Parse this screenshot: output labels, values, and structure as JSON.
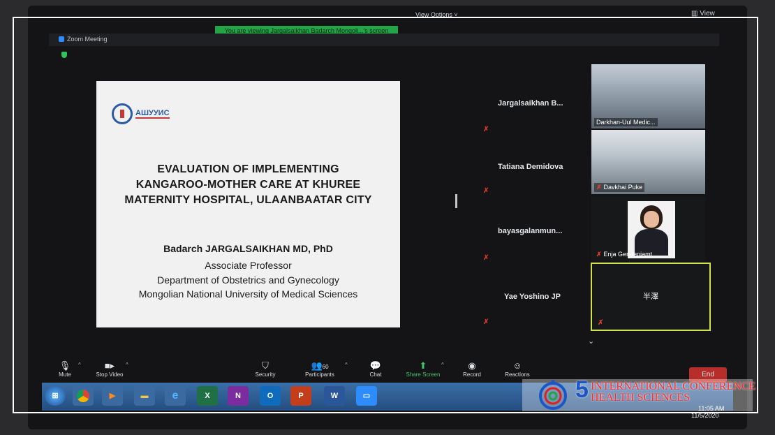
{
  "window": {
    "app_title": "Zoom Meeting",
    "viewing_banner": "You are viewing Jargalsaikhan Badarch Mongoli...'s screen",
    "view_options": "View Options ˅",
    "view_button": "View"
  },
  "slide": {
    "logo_text": "АШУУИС",
    "title_lines": [
      "EVALUATION OF IMPLEMENTING",
      "KANGAROO-MOTHER CARE AT KHUREE",
      "MATERNITY HOSPITAL, ULAANBAATAR CITY"
    ],
    "author": "Badarch JARGALSAIKHAN MD, PhD",
    "role": "Associate Professor",
    "department": "Department of Obstetrics and Gynecology",
    "university": "Mongolian National University of Medical Sciences"
  },
  "participants": [
    {
      "name": "Jargalsaikhan B...",
      "tile_label": "Darkhan-Uul Medic..."
    },
    {
      "name": "Tatiana Demidova",
      "tile_label": "Davkhai Puke"
    },
    {
      "name": "bayasgalanmun...",
      "tile_label": "Enja Gendenjamt..."
    },
    {
      "name": "Yae Yoshino JP",
      "tile_label": "半澤"
    }
  ],
  "toolbar": {
    "mute": "Mute",
    "stop_video": "Stop Video",
    "security": "Security",
    "participants": "Participants",
    "participants_count": "60",
    "chat": "Chat",
    "share_screen": "Share Screen",
    "record": "Record",
    "reactions": "Reactions",
    "end": "End"
  },
  "taskbar": {
    "clock": "11:05 AM",
    "date": "11/5/2020",
    "apps": [
      "start-icon",
      "chrome-icon",
      "media-player-icon",
      "file-explorer-icon",
      "internet-explorer-icon",
      "excel-icon",
      "onenote-icon",
      "outlook-icon",
      "powerpoint-icon",
      "word-icon",
      "zoom-icon"
    ]
  },
  "watermark": {
    "number": "5",
    "line1": "INTERNATIONAL CONFERENCE",
    "line2": "HEALTH SCIENCES"
  },
  "colors": {
    "banner_green": "#22a447",
    "mute_red": "#d23a2a",
    "active_speaker": "#d2e34a",
    "end_red": "#c9302c",
    "conference_red": "#ff2a2a",
    "conference_blue": "#1d55c4"
  }
}
